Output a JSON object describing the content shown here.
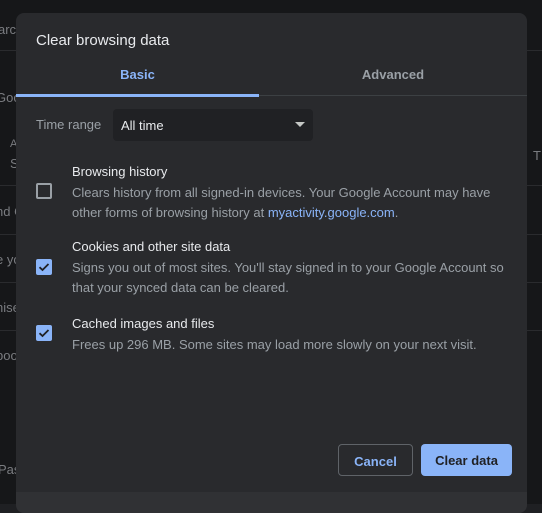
{
  "background": {
    "fragments": [
      "arc",
      "Goo",
      "A",
      "S",
      "nd C",
      "e yo",
      "nise",
      "boo",
      "Pas",
      "T"
    ]
  },
  "dialog": {
    "title": "Clear browsing data",
    "tabs": [
      {
        "label": "Basic",
        "active": true
      },
      {
        "label": "Advanced",
        "active": false
      }
    ],
    "time_range": {
      "label": "Time range",
      "value": "All time"
    },
    "items": [
      {
        "title": "Browsing history",
        "desc_before": "Clears history from all signed-in devices. Your Google Account may have other forms of browsing history at ",
        "link": "myactivity.google.com",
        "desc_after": ".",
        "checked": false
      },
      {
        "title": "Cookies and other site data",
        "desc": "Signs you out of most sites. You'll stay signed in to your Google Account so that your synced data can be cleared.",
        "checked": true
      },
      {
        "title": "Cached images and files",
        "desc": "Frees up 296 MB. Some sites may load more slowly on your next visit.",
        "checked": true
      }
    ],
    "buttons": {
      "cancel": "Cancel",
      "clear": "Clear data"
    }
  },
  "colors": {
    "accent": "#8ab4f8",
    "dialog_bg": "#292a2d"
  }
}
